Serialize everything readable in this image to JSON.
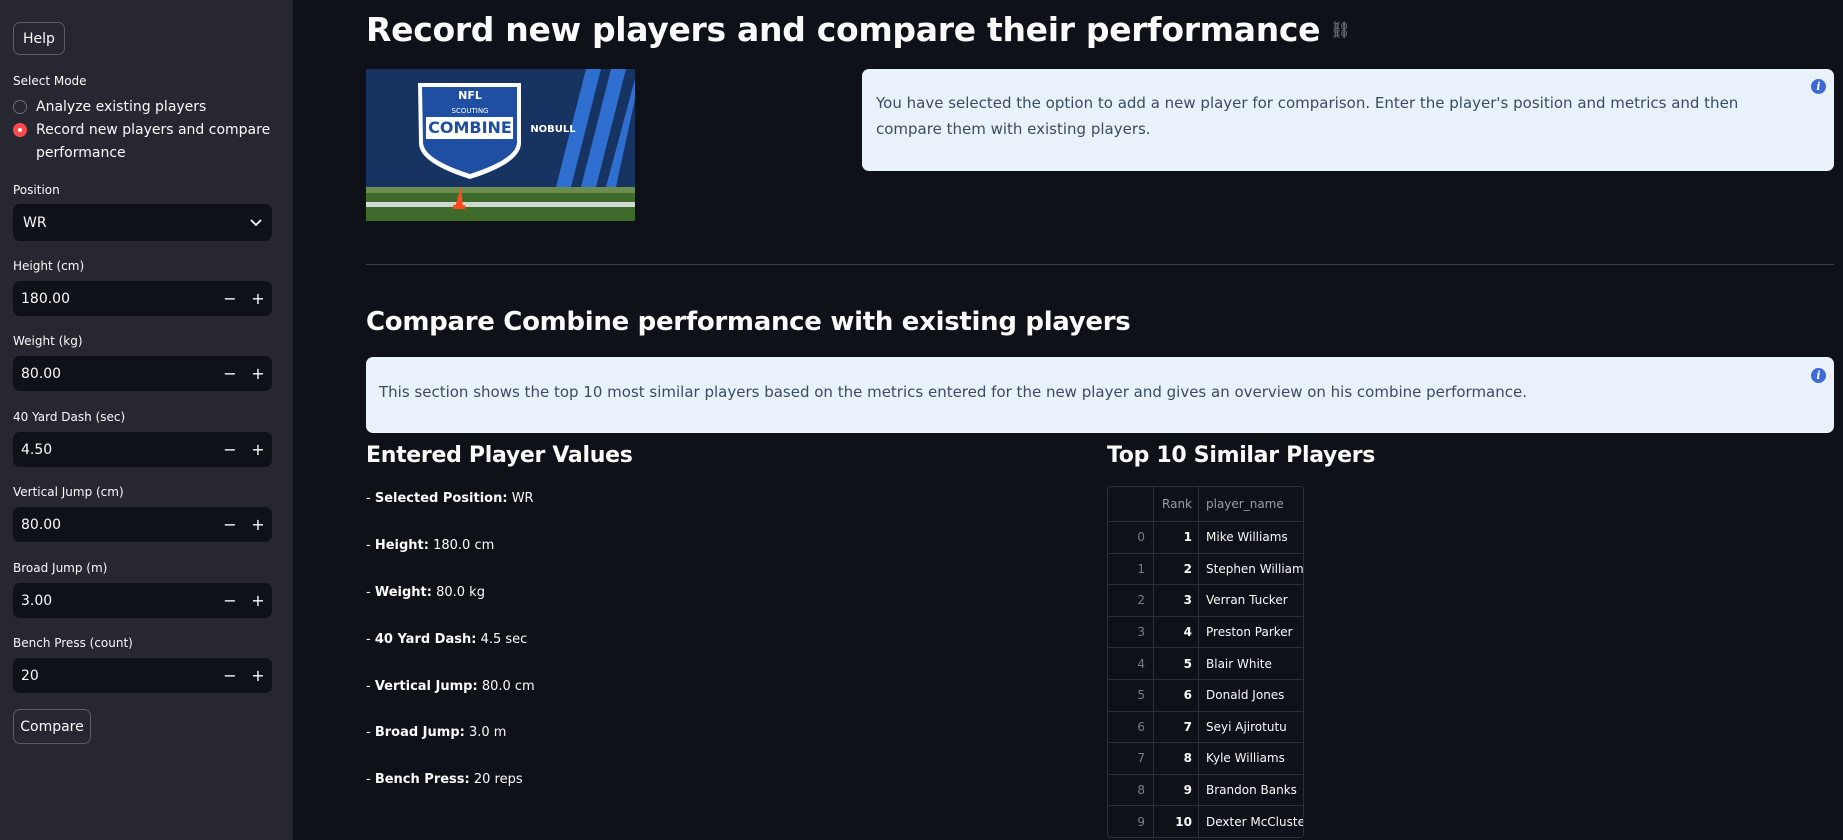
{
  "sidebar": {
    "help_label": "Help",
    "mode_label": "Select Mode",
    "mode_options": [
      "Analyze existing players",
      "Record new players and compare",
      "performance"
    ],
    "position_label": "Position",
    "position_value": "WR",
    "fields": [
      {
        "label": "Height (cm)",
        "value": "180.00"
      },
      {
        "label": "Weight (kg)",
        "value": "80.00"
      },
      {
        "label": "40 Yard Dash (sec)",
        "value": "4.50"
      },
      {
        "label": "Vertical Jump (cm)",
        "value": "80.00"
      },
      {
        "label": "Broad Jump (m)",
        "value": "3.00"
      },
      {
        "label": "Bench Press (count)",
        "value": "20"
      }
    ],
    "compare_label": "Compare"
  },
  "main": {
    "title": "Record new players and compare their performance",
    "info1": "You have selected the option to add a new player for comparison. Enter the player's position and metrics and then compare them with existing players.",
    "section_title": "Compare Combine performance with existing players",
    "info2": "This section shows the top 10 most similar players based on the metrics entered for the new player and gives an overview on his combine performance.",
    "entered_title": "Entered Player Values",
    "metrics": [
      {
        "prefix": "- ",
        "key": "Selected Position:",
        "value": " WR"
      },
      {
        "prefix": "- ",
        "key": "Height:",
        "value": " 180.0 cm"
      },
      {
        "prefix": "- ",
        "key": "Weight:",
        "value": " 80.0 kg"
      },
      {
        "prefix": "- ",
        "key": "40 Yard Dash:",
        "value": " 4.5 sec"
      },
      {
        "prefix": "- ",
        "key": "Vertical Jump:",
        "value": " 80.0 cm"
      },
      {
        "prefix": "- ",
        "key": "Broad Jump:",
        "value": " 3.0 m"
      },
      {
        "prefix": "- ",
        "key": "Bench Press:",
        "value": " 20 reps"
      }
    ],
    "similar_title": "Top 10 Similar Players",
    "table": {
      "headers": [
        "",
        "Rank",
        "player_name"
      ],
      "rows": [
        [
          "0",
          "1",
          "Mike Williams"
        ],
        [
          "1",
          "2",
          "Stephen Williams"
        ],
        [
          "2",
          "3",
          "Verran Tucker"
        ],
        [
          "3",
          "4",
          "Preston Parker"
        ],
        [
          "4",
          "5",
          "Blair White"
        ],
        [
          "5",
          "6",
          "Donald Jones"
        ],
        [
          "6",
          "7",
          "Seyi Ajirotutu"
        ],
        [
          "7",
          "8",
          "Kyle Williams"
        ],
        [
          "8",
          "9",
          "Brandon Banks"
        ],
        [
          "9",
          "10",
          "Dexter McCluster"
        ]
      ]
    },
    "banner": {
      "shield_top": "NFL",
      "shield_sub": "SCOUTING",
      "shield_main": "COMBINE",
      "sponsor": "NOBULL"
    }
  },
  "colors": {
    "accent": "#ff4b4b",
    "info_bg": "#e9f2fb",
    "info_icon": "#3e6ad8"
  }
}
